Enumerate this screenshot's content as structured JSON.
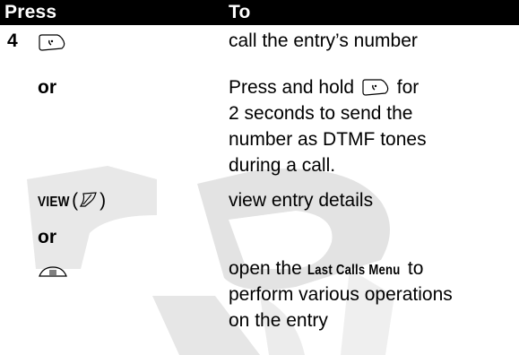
{
  "header": {
    "col1": "Press",
    "col2": "To"
  },
  "rows": {
    "r1": {
      "step": "4",
      "icon": "send-key-icon",
      "text": "call the entry’s number"
    },
    "r2": {
      "label": "or",
      "text_before": "Press and hold",
      "icon": "send-key-icon",
      "text_after": "for",
      "line2": "2 seconds to send the",
      "line3": "number as DTMF tones",
      "line4": "during a call."
    },
    "r3": {
      "key": "VIEW",
      "paren_open": "(",
      "icon": "right-soft-key-icon",
      "paren_close": ")",
      "text": "view entry details"
    },
    "r4": {
      "label": "or"
    },
    "r5": {
      "icon": "menu-key-icon",
      "text_before": "open the",
      "menu_name": "Last Calls Menu",
      "text_after": "to",
      "line2": "perform various operations",
      "line3": "on the entry"
    }
  },
  "colors": {
    "header_bg": "#000000",
    "header_text": "#ffffff",
    "watermark": "#d9d9d9"
  }
}
